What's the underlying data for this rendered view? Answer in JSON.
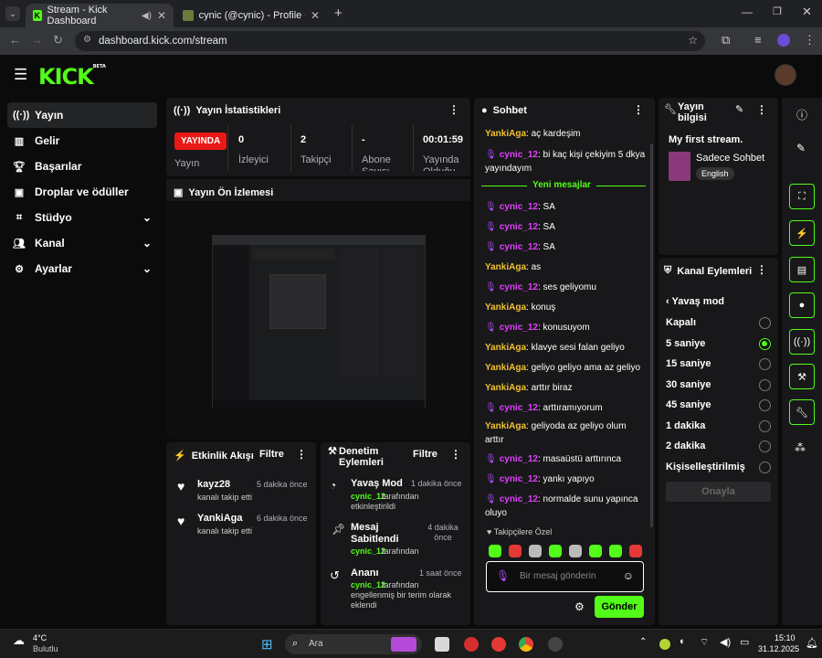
{
  "browser": {
    "tabs": [
      {
        "label": "Stream - Kick Dashboard",
        "active": true
      },
      {
        "label": "cynic (@cynic) - Profile - Quizei",
        "active": false
      }
    ],
    "url": "dashboard.kick.com/stream"
  },
  "header": {
    "logo": "KICK",
    "logo_badge": "BETA"
  },
  "sidebar": {
    "items": [
      {
        "label": "Yayın",
        "icon": "broadcast-icon"
      },
      {
        "label": "Gelir",
        "icon": "revenue-icon"
      },
      {
        "label": "Başarılar",
        "icon": "trophy-icon"
      },
      {
        "label": "Droplar ve ödüller",
        "icon": "gift-icon"
      },
      {
        "label": "Stüdyo",
        "icon": "studio-icon"
      },
      {
        "label": "Kanal",
        "icon": "users-icon"
      },
      {
        "label": "Ayarlar",
        "icon": "gear-icon"
      }
    ]
  },
  "stats": {
    "title": "Yayın İstatistikleri",
    "live_badge": "YAYINDA",
    "live_label": "Yayın",
    "items": [
      {
        "value": "0",
        "label": "İzleyici"
      },
      {
        "value": "2",
        "label": "Takipçi"
      },
      {
        "value": "-",
        "label": "Abone Sayısı"
      },
      {
        "value": "00:01:59",
        "label": "Yayında Olduğu"
      }
    ]
  },
  "preview": {
    "title": "Yayın Ön İzlemesi"
  },
  "activity": {
    "title": "Etkinlik Akışı",
    "filter": "Filtre",
    "items": [
      {
        "user": "kayz28",
        "text": "kanalı takip etti",
        "time": "5 dakika önce"
      },
      {
        "user": "YankiAga",
        "text": "kanalı takip etti",
        "time": "6 dakika önce"
      }
    ]
  },
  "moderation": {
    "title": "Denetim Eylemleri",
    "filter": "Filtre",
    "items": [
      {
        "title": "Yavaş Mod",
        "actor": "cynic_12",
        "rest": "tarafından etkinleştirildi",
        "time": "1 dakika önce"
      },
      {
        "title": "Mesaj Sabitlendi",
        "actor": "cynic_12",
        "rest": "tarafından",
        "time": "4 dakika önce"
      },
      {
        "title": "Ananı",
        "actor": "cynic_12",
        "rest": "tarafından engellenmiş bir terim olarak eklendi",
        "time": "1 saat önce"
      }
    ]
  },
  "chat": {
    "title": "Sohbet",
    "new_messages": "Yeni mesajlar",
    "messages": [
      {
        "user": "YankiAga",
        "text": "aç kardeşim",
        "type": "y"
      },
      {
        "user": "cynic_12",
        "text": "bi kaç kişi çekiyim 5 dkya yayındayım",
        "type": "c"
      },
      {
        "user": "cynic_12",
        "text": "SA",
        "type": "c"
      },
      {
        "user": "cynic_12",
        "text": "SA",
        "type": "c"
      },
      {
        "user": "cynic_12",
        "text": "SA",
        "type": "c"
      },
      {
        "user": "YankiAga",
        "text": "as",
        "type": "y"
      },
      {
        "user": "cynic_12",
        "text": "ses geliyomu",
        "type": "c"
      },
      {
        "user": "YankiAga",
        "text": "konuş",
        "type": "y"
      },
      {
        "user": "cynic_12",
        "text": "konusuyom",
        "type": "c"
      },
      {
        "user": "YankiAga",
        "text": "klavye sesi falan geliyo",
        "type": "y"
      },
      {
        "user": "YankiAga",
        "text": "geliyo geliyo ama az geliyo",
        "type": "y"
      },
      {
        "user": "YankiAga",
        "text": "arttır biraz",
        "type": "y"
      },
      {
        "user": "cynic_12",
        "text": "arttıramıyorum",
        "type": "c"
      },
      {
        "user": "YankiAga",
        "text": "geliyoda az geliyo olum arttır",
        "type": "y"
      },
      {
        "user": "cynic_12",
        "text": "masaüstü arttırınca",
        "type": "c"
      },
      {
        "user": "cynic_12",
        "text": "yankı yapıyo",
        "type": "c"
      },
      {
        "user": "cynic_12",
        "text": "normalde sunu yapınca oluyo",
        "type": "c"
      }
    ],
    "follower_only": "Takipçilere Özel",
    "placeholder": "Bir mesaj gönderin",
    "send": "Gönder"
  },
  "stream_info": {
    "title": "Yayın bilgisi",
    "stream_title": "My first stream.",
    "category": "Sadece Sohbet",
    "language": "English"
  },
  "channel_actions": {
    "title": "Kanal Eylemleri",
    "back_label": "Yavaş mod",
    "options": [
      "Kapalı",
      "5 saniye",
      "15 saniye",
      "30 saniye",
      "45 saniye",
      "1 dakika",
      "2 dakika",
      "Kişiselleştirilmiş"
    ],
    "selected": "5 saniye",
    "confirm": "Onayla"
  },
  "taskbar": {
    "weather_temp": "4°C",
    "weather_label": "Bulutlu",
    "search": "Ara",
    "time": "15:10",
    "date": "31.12.2025"
  },
  "colors": {
    "accent": "#53fc18",
    "live": "#e91916",
    "yanki": "#f2c12e",
    "cynic": "#e040fb"
  }
}
